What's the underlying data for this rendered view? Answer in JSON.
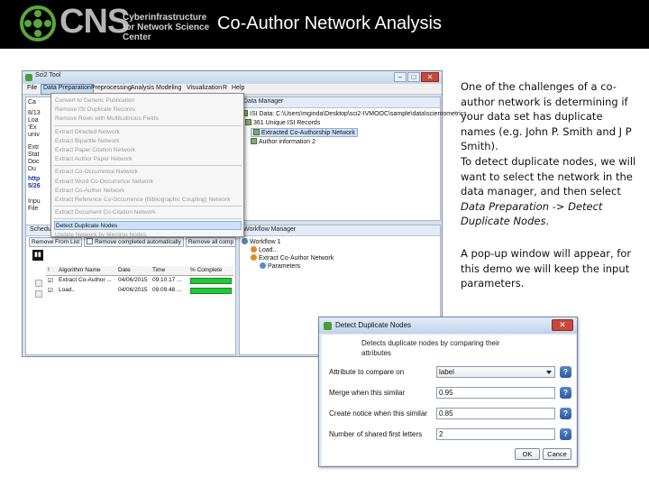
{
  "header": {
    "logo_text": "CNS",
    "logo_subtext": "Cyberinfrastructure for Network Science Center",
    "title": "Co-Author Network Analysis"
  },
  "sci2_window": {
    "title": "Sci2 Tool",
    "menu": [
      "File",
      "Data Preparation",
      "Preprocessing",
      "Analysis",
      "Modeling",
      "Visualization",
      "R",
      "Help"
    ],
    "active_menu": "Data Preparation",
    "console_lines": [
      "Ca",
      "8/13",
      "Loa",
      "'Ex",
      "univ",
      "Extr",
      "Stat",
      "Doc",
      "Du",
      "http",
      "5/26",
      "Inpu",
      "File"
    ],
    "data_manager": {
      "title": "Data Manager",
      "items": [
        "ISI Data: C:\\Users\\mginda\\Desktop\\sci2-IVMOOC\\sample\\data\\scientometrics",
        "361 Unique ISI Records",
        "Extracted Co-Authorship Network",
        "Author information 2"
      ]
    },
    "workflow_manager": {
      "title": "Workflow Manager",
      "items": [
        "Workflow 1",
        "Load...",
        "Extract Co-Author Network",
        "Parameters"
      ]
    },
    "scheduler": {
      "title": "Scheduler",
      "remove_from_list": "Remove From List",
      "remove_auto": "Remove completed automatically",
      "remove_all": "Remove all comp",
      "headers": [
        "!",
        "Algorithm Name",
        "Date",
        "Time",
        "% Complete"
      ],
      "rows": [
        {
          "name": "Extract Co-Author ...",
          "date": "04/06/2015",
          "time": "09:10:17 ...",
          "progress": 100
        },
        {
          "name": "Load..",
          "date": "04/06/2015",
          "time": "09:09:48 ...",
          "progress": 100
        }
      ]
    },
    "dropdown": [
      {
        "label": "Convert to Generic Publication",
        "enabled": false
      },
      {
        "label": "Remove ISI Duplicate Records",
        "enabled": false
      },
      {
        "label": "Remove Rows with Multitudinous Fields",
        "enabled": false
      },
      {
        "sep": true
      },
      {
        "label": "Extract Directed Network",
        "enabled": false
      },
      {
        "label": "Extract Bipartite Network",
        "enabled": false
      },
      {
        "label": "Extract Paper Citation Network",
        "enabled": false
      },
      {
        "label": "Extract Author Paper Network",
        "enabled": false
      },
      {
        "sep": true
      },
      {
        "label": "Extract Co-Occurrence Network",
        "enabled": false
      },
      {
        "label": "Extract Word Co-Occurrence Network",
        "enabled": false
      },
      {
        "label": "Extract Co-Author Network",
        "enabled": false
      },
      {
        "label": "Extract Reference Co-Occurrence (Bibliographic Coupling) Network",
        "enabled": false
      },
      {
        "sep": true
      },
      {
        "label": "Extract Document Co-Citation Network",
        "enabled": false
      },
      {
        "sep": true
      },
      {
        "label": "Detect Duplicate Nodes",
        "enabled": true,
        "highlighted": true
      },
      {
        "label": "Update Network by Merging Nodes",
        "enabled": false
      }
    ]
  },
  "dialog": {
    "title": "Detect Duplicate Nodes",
    "description": "Detects duplicate nodes by comparing their attributes",
    "fields": [
      {
        "label": "Attribute to compare on",
        "value": "label",
        "type": "select"
      },
      {
        "label": "Merge when this similar",
        "value": "0.95",
        "type": "text"
      },
      {
        "label": "Create notice when this similar",
        "value": "0.85",
        "type": "text"
      },
      {
        "label": "Number of shared first letters",
        "value": "2",
        "type": "text"
      }
    ],
    "ok_label": "OK",
    "cancel_label": "Cance"
  },
  "description": {
    "para1": "One of the challenges of a co-author network is determining if your data set has duplicate names (e.g. John P. Smith and J P Smith).",
    "para2_prefix": "To detect duplicate nodes, we will want to select the network in the data manager, and then select ",
    "para2_italic": "Data Preparation -> Detect Duplicate Nodes",
    "para2_suffix": ".",
    "para3": "A pop-up window will appear, for this demo we will keep the input parameters."
  },
  "colors": {
    "header_bg": "#000000",
    "progress_green": "#24c63a",
    "highlight_blue": "#cde0f6"
  }
}
